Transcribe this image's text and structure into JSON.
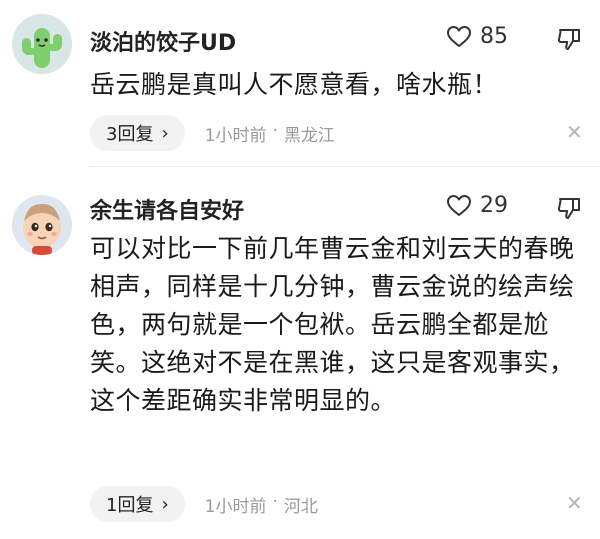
{
  "comments": [
    {
      "username": "淡泊的饺子UD",
      "likes": "85",
      "text": "岳云鹏是真叫人不愿意看，啥水瓶！",
      "reply_label": "3回复",
      "time": "1小时前",
      "location": "黑龙江",
      "avatar_icon": "cactus-avatar"
    },
    {
      "username": "余生请各自安好",
      "likes": "29",
      "text": "可以对比一下前几年曹云金和刘云天的春晚相声，同样是十几分钟，曹云金说的绘声绘色，两句就是一个包袱。岳云鹏全都是尬笑。这绝对不是在黑谁，这只是客观事实，这个差距确实非常明显的。",
      "reply_label": "1回复",
      "time": "1小时前",
      "location": "河北",
      "avatar_icon": "cartoon-baby-avatar"
    }
  ],
  "separator": "·",
  "chevron": "›",
  "close_glyph": "✕",
  "colors": {
    "text": "#1a1a1a",
    "muted": "#9a9a9a",
    "pill": "#f2f2f2",
    "cactus": "#7fcf6e"
  }
}
